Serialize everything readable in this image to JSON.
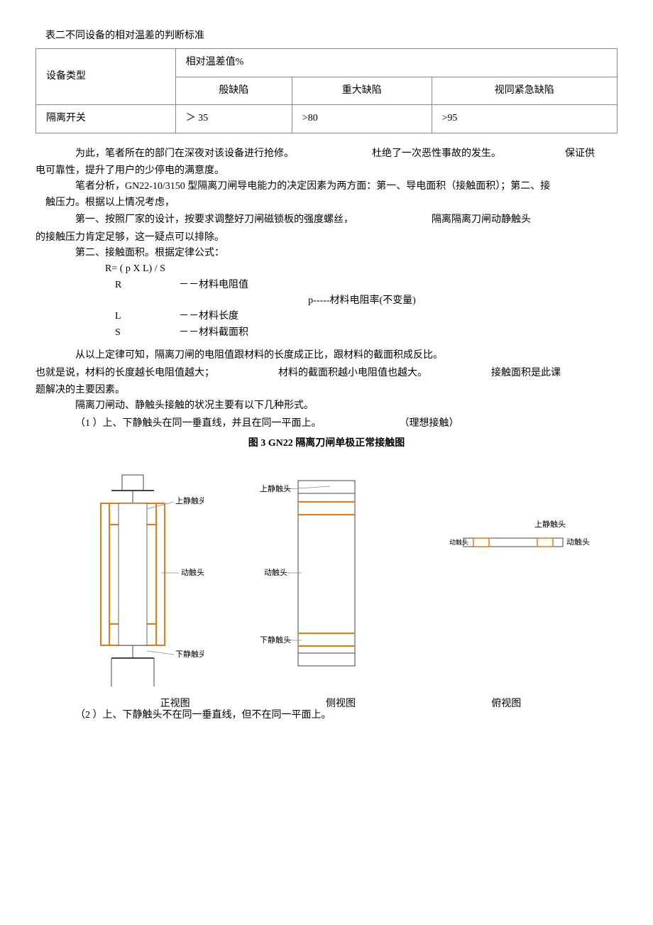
{
  "table_caption": "表二不同设备的相对温差的判断标准",
  "table": {
    "header_left": "设备类型",
    "header_right": "相对温差值%",
    "sub_headers": [
      "般缺陷",
      "重大缺陷",
      "视同紧急缺陷"
    ],
    "row": [
      "隔离开关",
      "＞ 35",
      ">80",
      ">95"
    ]
  },
  "para1": {
    "a": "为此，笔者所在的部门在深夜对该设备进行抢修。",
    "b": "杜绝了一次恶性事故的发生。",
    "c": "保证供"
  },
  "para1b": "电可靠性，提升了用户的少停电的满意度。",
  "para2a": "笔者分析，GN22-10/3150 型隔离刀闸导电能力的决定因素为两方面：第一、导电面积（接触面积）；第二、接",
  "para2b": "触压力。根据以上情况考虑，",
  "para3": {
    "a": "第一、按照厂家的设计，按要求调整好刀闸磁锁板的强度螺丝，",
    "b": "隔离隔离刀闸动静触头"
  },
  "para3b": "的接触压力肯定足够，这一疑点可以排除。",
  "para4": "第二、接触面积。根据定律公式：",
  "formula": "R= ( p X L) / S",
  "vars": {
    "R": {
      "v": "R",
      "d": "－－材料电阻值"
    },
    "p": "p-----材料电阻率(不变量)",
    "L": {
      "v": "L",
      "d": "－－材料长度"
    },
    "S": {
      "v": "S",
      "d": "－－材料截面积"
    }
  },
  "para5": "从以上定律可知，隔离刀闸的电阻值跟材料的长度成正比，跟材料的截面积成反比。",
  "para6": {
    "a": "也就是说，材料的长度越长电阻值越大；",
    "b": "材料的截面积越小电阻值也越大。",
    "c": "接触面积是此课"
  },
  "para6b": "题解决的主要因素。",
  "para7": "隔离刀闸动、静触头接触的状况主要有以下几种形式。",
  "item1": {
    "a": "（1 ）上、下静触头在同一垂直线，并且在同一平面上。",
    "b": "（理想接触）"
  },
  "fig_title": "图 3 GN22 隔离刀闸单极正常接触图",
  "fig_labels": {
    "upper_static": "上静触头",
    "moving": "动触头",
    "lower_static": "下静触头",
    "moving_small": "动触头"
  },
  "view_captions": {
    "front": "正视图",
    "side": "侧视图",
    "top": "俯视图"
  },
  "item2": "（2 ）上、下静触头不在同一垂直线，但不在同一平面上。"
}
